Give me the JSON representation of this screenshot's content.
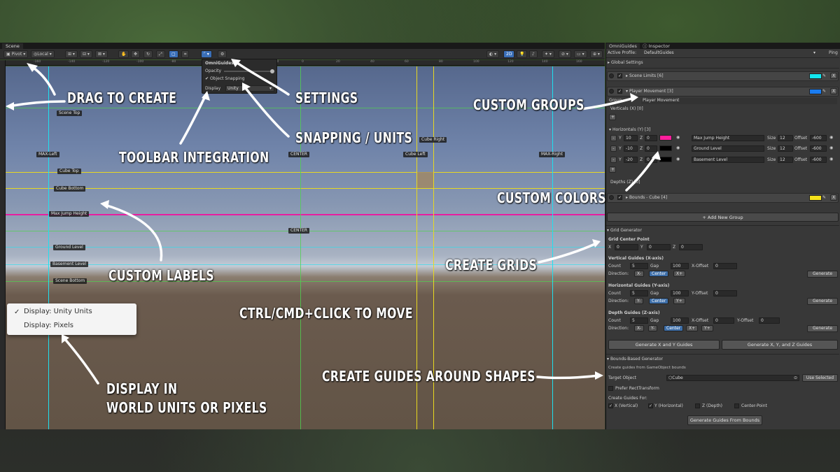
{
  "scene": {
    "tab": "Scene",
    "toolbar": {
      "pivot": "Pivot",
      "local": "Local",
      "mode_2d": "2D"
    },
    "ruler_ticks": [
      "-160",
      "-140",
      "-120",
      "-100",
      "-80",
      "-60",
      "-40",
      "-20",
      "0",
      "20",
      "40",
      "60",
      "80",
      "100",
      "120",
      "140",
      "160"
    ],
    "labels": {
      "scene_top": "Scene Top",
      "max_left": "MAX-Left",
      "center_top": "CENTER",
      "cube_left": "Cube Left",
      "cube_right": "Cube Right",
      "max_right": "MAX-Right",
      "cube_top": "Cube Top",
      "cube_bottom": "Cube Bottom",
      "max_jump": "Max Jump Height",
      "center_mid": "CENTER",
      "ground_level": "Ground Level",
      "basement_level": "Basement Level",
      "scene_bottom": "Scene Bottom"
    },
    "popup": {
      "title": "OmniGuides",
      "opacity_label": "Opacity",
      "snapping_label": "Object Snapping",
      "display_label": "Display",
      "display_value": "Unity"
    },
    "display_menu": {
      "items": [
        "Display: Unity Units",
        "Display: Pixels"
      ],
      "checked": "Display: Unity Units"
    }
  },
  "inspector": {
    "tabs": [
      "OmniGuides",
      "Inspector"
    ],
    "active_profile_label": "Active Profile:",
    "active_profile_value": "DefaultGuides",
    "ping": "Ping",
    "global_settings": "Global Settings",
    "groups": [
      {
        "name": "Scene Limits [6]",
        "color": "#13e6ef"
      },
      {
        "name": "Player Movement [3]",
        "color": "#1a7cf0"
      },
      {
        "name": "Bounds - Cube [4]",
        "color": "#f5e21b"
      }
    ],
    "group_label": "Group",
    "group_value": "Player Movement",
    "verticals_label": "Verticals (X) [0]",
    "horizontals_label": "Horizontals (Y) [3]",
    "depths_label": "Depths (Z) [0]",
    "horizontal_rows": [
      {
        "y": "10",
        "z": "0",
        "color": "#ff1e9c",
        "name": "Max Jump Height",
        "size": "12",
        "offset": "-600"
      },
      {
        "y": "-10",
        "z": "0",
        "color": "#000000",
        "name": "Ground Level",
        "size": "12",
        "offset": "-600"
      },
      {
        "y": "-20",
        "z": "0",
        "color": "#000000",
        "name": "Basement Level",
        "size": "12",
        "offset": "-600"
      }
    ],
    "row_labels": {
      "y": "Y",
      "z": "Z",
      "size": "Size",
      "offset": "Offset",
      "minus": "-",
      "plus": "+",
      "close": "X"
    },
    "add_group": "+ Add New Group",
    "grid": {
      "title": "Grid Generator",
      "center_title": "Grid Center Point",
      "cx": "0",
      "cy": "0",
      "cz": "0",
      "x_label": "X",
      "y_label": "Y",
      "z_label": "Z",
      "count_label": "Count",
      "gap_label": "Gap",
      "direction_label": "Direction:",
      "vertical_title": "Vertical Guides (X-axis)",
      "v_count": "5",
      "v_gap": "100",
      "v_offset_label": "X-Offset",
      "v_offset": "0",
      "v_dirs": [
        "X-",
        "Center",
        "X+"
      ],
      "horizontal_title": "Horizontal Guides (Y-axis)",
      "h_count": "5",
      "h_gap": "100",
      "h_offset_label": "Y-Offset",
      "h_offset": "0",
      "h_dirs": [
        "Y-",
        "Center",
        "Y+"
      ],
      "depth_title": "Depth Guides (Z-axis)",
      "d_count": "5",
      "d_gap": "100",
      "d_xoffset_label": "X-Offset",
      "d_xoffset": "0",
      "d_yoffset_label": "Y-Offset",
      "d_yoffset": "0",
      "d_dirs": [
        "X-",
        "Y-",
        "Center",
        "X+",
        "Y+"
      ],
      "generate": "Generate",
      "gen_xy": "Generate X and Y Guides",
      "gen_xyz": "Generate X, Y, and Z Guides"
    },
    "bounds": {
      "title": "Bounds-Based Generator",
      "desc": "Create guides from GameObject bounds",
      "target_label": "Target Object",
      "target_value": "Cube",
      "use_selected": "Use Selected",
      "prefer_rect": "Prefer RectTransform",
      "create_for": "Create Guides For:",
      "opts": [
        "X (Vertical)",
        "Y (Horizontal)",
        "Z (Depth)",
        "Center-Point"
      ],
      "generate": "Generate Guides From Bounds"
    }
  },
  "callouts": {
    "drag_to_create": "DRAG TO CREATE",
    "settings": "SETTINGS",
    "custom_groups": "CUSTOM GROUPS",
    "snapping_units": "SNAPPING / UNITS",
    "toolbar_integration": "TOOLBAR INTEGRATION",
    "custom_colors": "CUSTOM COLORS",
    "create_grids": "CREATE GRIDS",
    "custom_labels": "CUSTOM LABELS",
    "ctrl_click": "CTRL/CMD+CLICK TO MOVE",
    "create_guides_shapes": "CREATE GUIDES AROUND SHAPES",
    "display_line1": "DISPLAY IN",
    "display_line2": "WORLD UNITS OR PIXELS"
  },
  "colors": {
    "cyan_guide": "#1ee0f0",
    "magenta_guide": "#e81ea0",
    "yellow_guide": "#e8d820",
    "green_guide": "#4ed04e",
    "accent_blue": "#3a6fb8"
  }
}
